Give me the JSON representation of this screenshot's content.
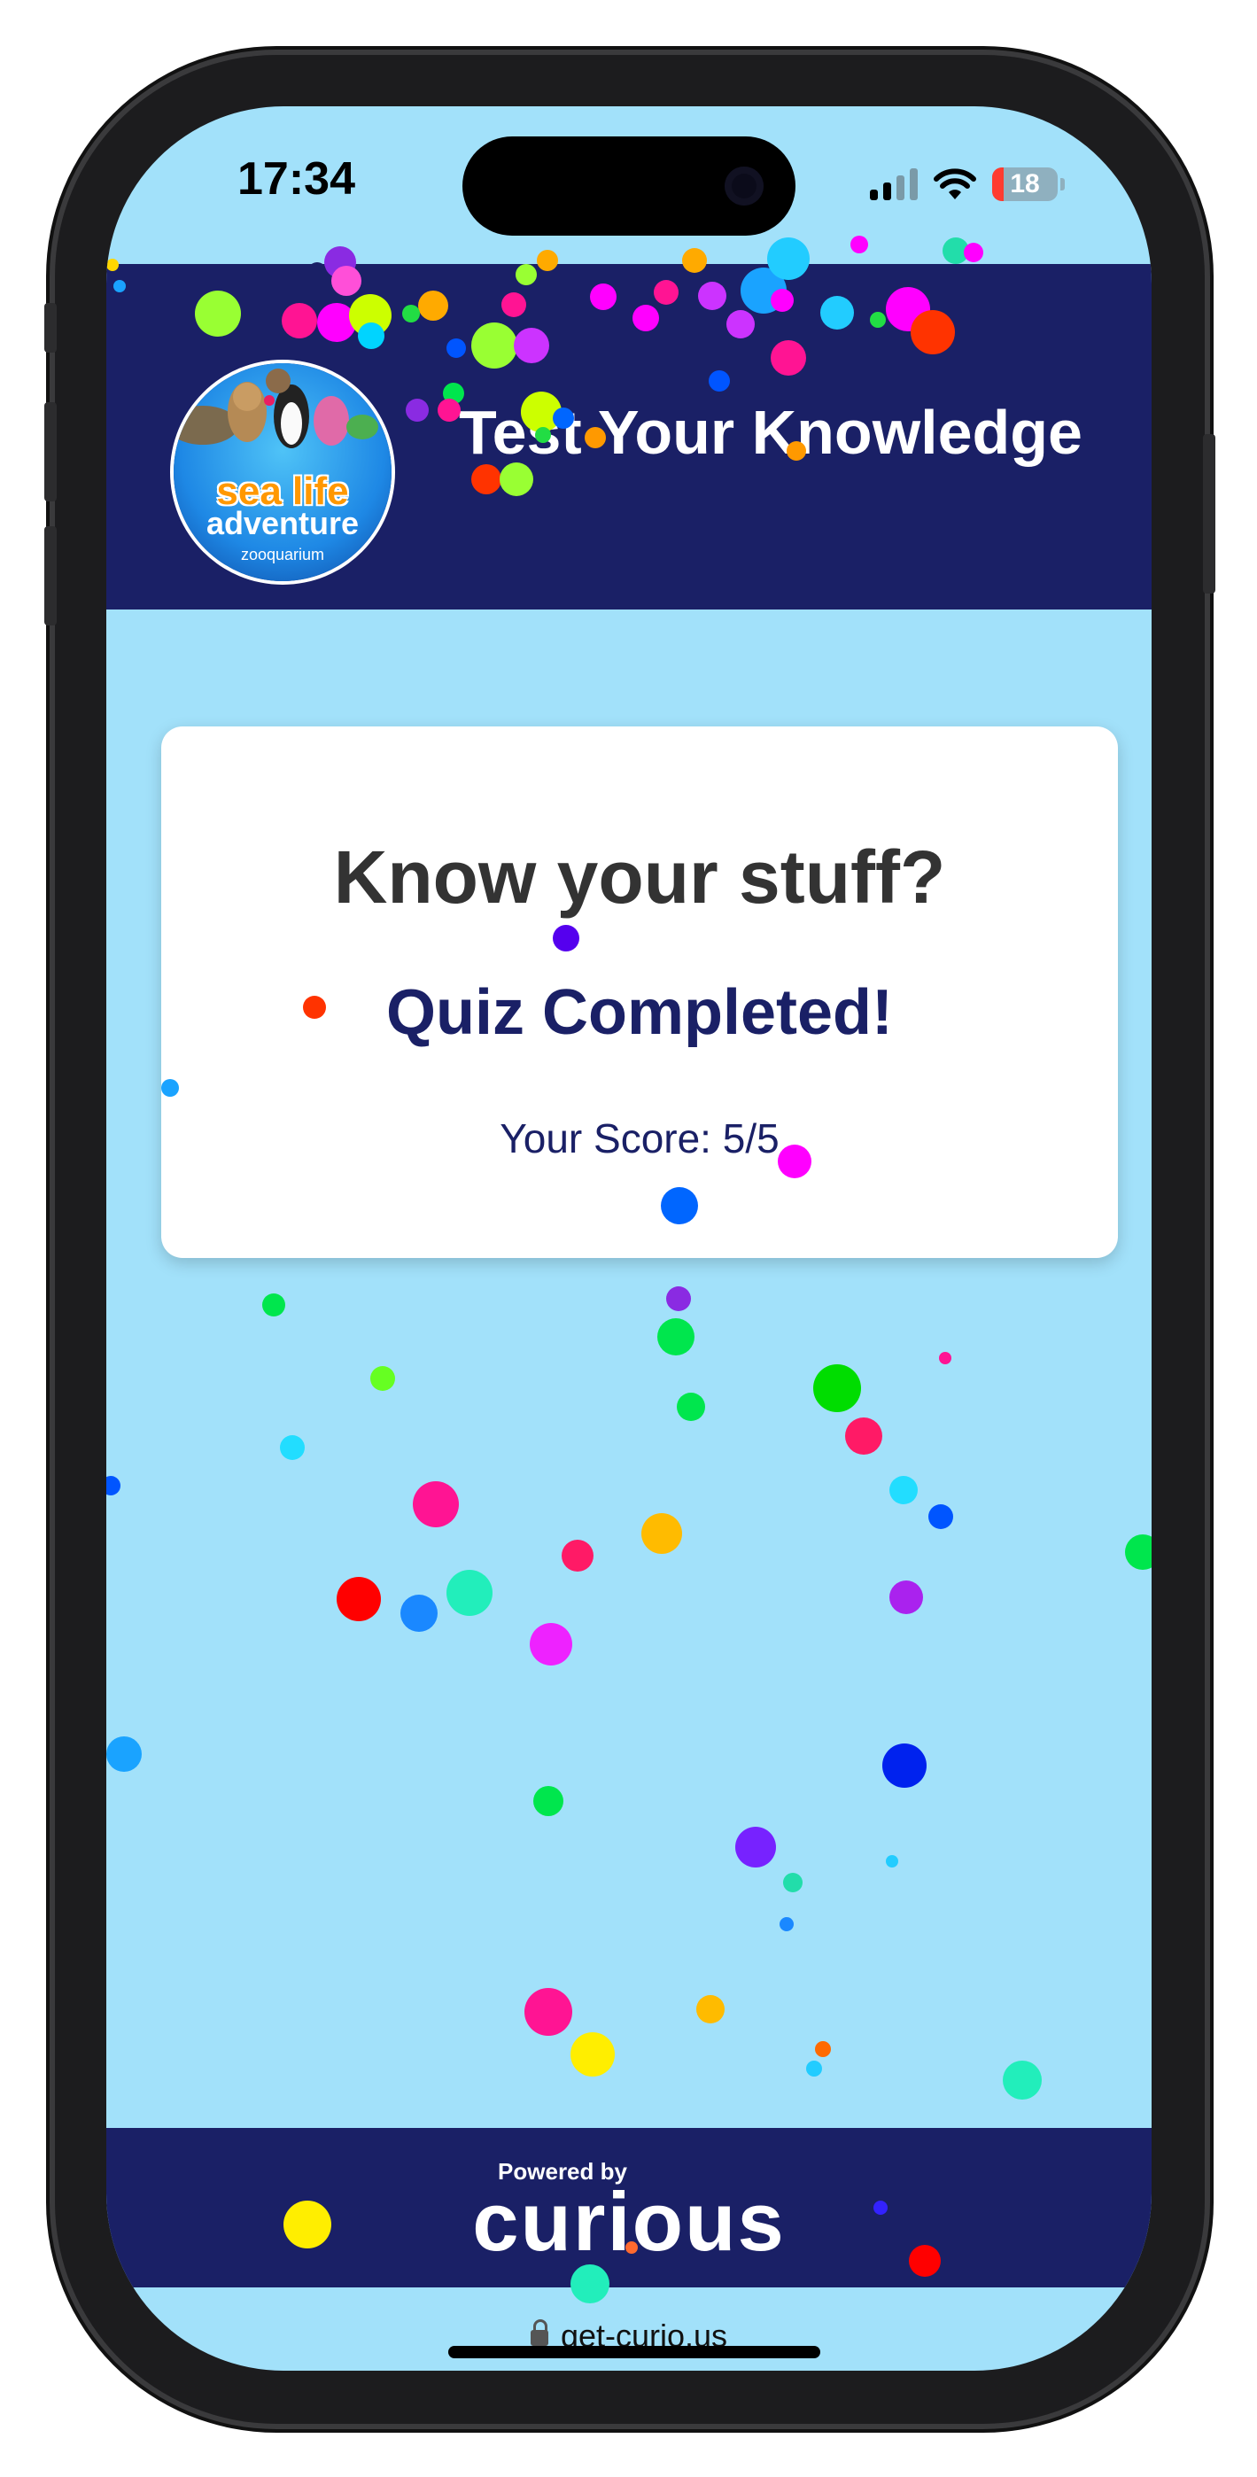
{
  "status_bar": {
    "time": "17:34",
    "battery_percent": "18",
    "battery_level": 0.18,
    "signal_bars": 2,
    "icons": [
      "cellular-signal-icon",
      "wifi-icon",
      "battery-icon"
    ]
  },
  "header": {
    "logo": {
      "line1": "sea life",
      "line2": "adventure",
      "line3": "zooquarium"
    },
    "title": "Test Your Knowledge"
  },
  "quiz_card": {
    "heading": "Know your stuff?",
    "status": "Quiz Completed!",
    "score_text": "Your Score: 5/5"
  },
  "footer": {
    "powered_by": "Powered by",
    "brand": "curious"
  },
  "browser": {
    "url": "get-curio.us"
  },
  "colors": {
    "page_background": "#a2e1fa",
    "header_background": "#1a2066",
    "card_background": "#ffffff",
    "heading_text": "#333333",
    "accent_text": "#1a2066",
    "confetti": [
      "#00e64d",
      "#ff1493",
      "#ff00ff",
      "#0055ff",
      "#ffd700",
      "#ff3300",
      "#8a2be2",
      "#00d4ff",
      "#1aa3ff",
      "#22ddaa",
      "#99ff33",
      "#ffaa00"
    ]
  }
}
